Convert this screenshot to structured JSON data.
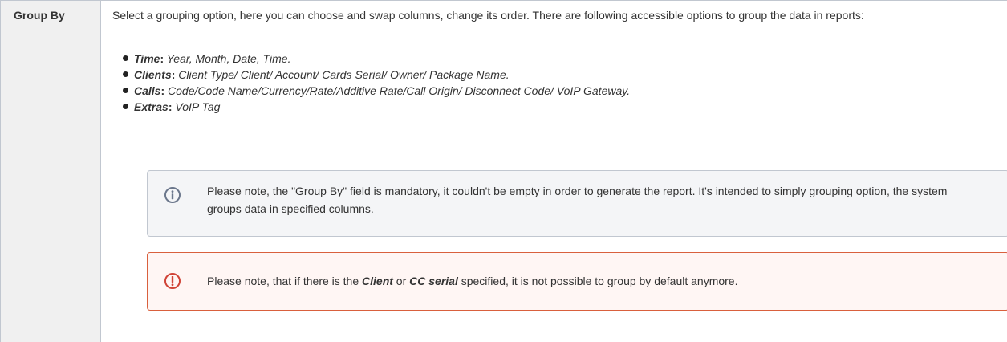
{
  "row": {
    "header": "Group By",
    "intro": "Select a grouping option, here you can choose and swap columns, change its order. There are following accessible options to group the data in reports:",
    "options": [
      {
        "name": "Time",
        "name_suffix": "",
        "colon": ":",
        "text": " Year, Month, Date, Time."
      },
      {
        "name": "Clients",
        "name_suffix": "",
        "colon": ":",
        "text": " Client Type/ Client/ Account/ Cards Serial/ Owner/ Package Name."
      },
      {
        "name": "Calls",
        "name_suffix": "",
        "colon": ":",
        "text": " Code/Code Name/Currency/Rate/Additive Rate/Call Origin/ Disconnect Code/ VoIP Gateway."
      },
      {
        "name": "Extras",
        "name_suffix": "",
        "colon": ":",
        "text": " VoIP Tag"
      }
    ],
    "info_panel": {
      "icon": "info-icon",
      "text": "Please note, the \"Group By\" field is mandatory, it couldn't be empty in order to generate the report. It's intended to simply grouping option, the system groups data in specified columns."
    },
    "warning_panel": {
      "icon": "warning-icon",
      "text_before": "Please note, that if there is the ",
      "client": "Client",
      "or": " or ",
      "cc_serial": "CC serial",
      "text_after": " specified, it is not possible to group by default anymore."
    }
  },
  "colors": {
    "info_icon": "#6b778c",
    "warning_icon": "#d04437",
    "warning_border": "#d9603d",
    "header_bg": "#f0f0f0"
  }
}
